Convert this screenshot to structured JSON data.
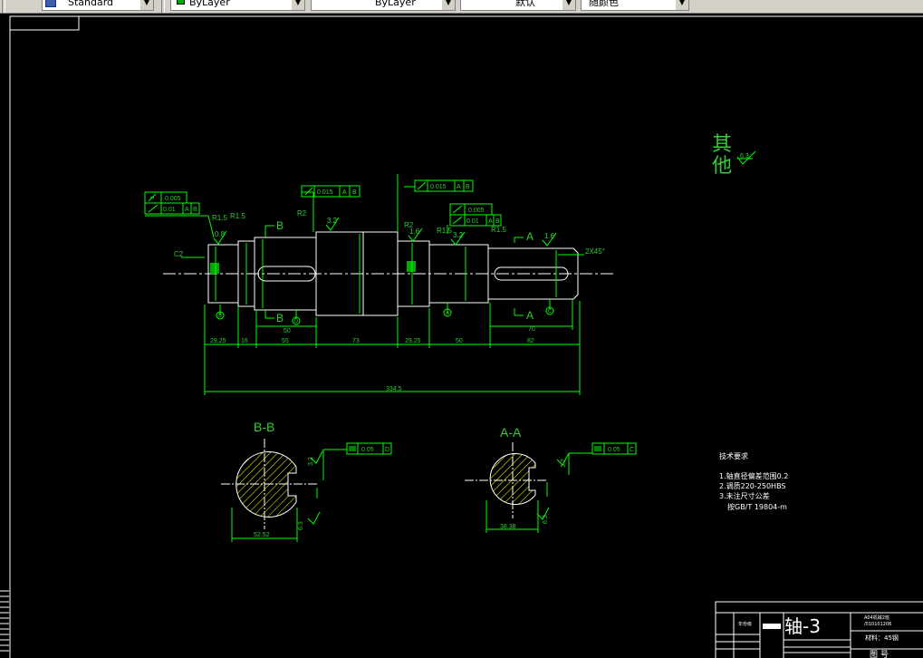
{
  "toolbar": {
    "text_style": "Standard",
    "layer_color": "ByLayer",
    "linetype": "ByLayer",
    "lineweight": "默认",
    "plot_color": "随颜色",
    "layer_color_hex": "#00aa00"
  },
  "drawing": {
    "colors": {
      "background": "#000000",
      "outline": "#ffffff",
      "dimension": "#00ff00",
      "text": "#33cc33",
      "hatch": "#ffff00"
    },
    "roughness_title_line1": "其",
    "roughness_title_line2": "他",
    "roughness_value": "6.3",
    "tolerance_frames": {
      "runout_1": "0.005",
      "runout_2": "0.01",
      "runout_2_datum_1": "A",
      "runout_2_datum_2": "B",
      "runout_3": "0.015",
      "runout_3_datum_1": "A",
      "runout_3_datum_2": "B",
      "runout_4": "0.015",
      "runout_4_datum_1": "A",
      "runout_4_datum_2": "B",
      "runout_5": "0.005",
      "runout_6": "0.01",
      "runout_6_datum_1": "A",
      "runout_6_datum_2": "B",
      "sym_bb": "0.05",
      "sym_bb_datum": "D",
      "sym_aa": "0.05",
      "sym_aa_datum": "C"
    },
    "labels": {
      "r15_1": "R1.5",
      "r15_2": "R1.5",
      "r15_3": "R1.5",
      "r15_4": "R1.5",
      "r2_1": "R2",
      "r2_2": "R2",
      "c2": "C2",
      "chamfer": "2X45°",
      "rough_08": "0.8",
      "rough_32_1": "3.2",
      "rough_16_1": "1.6",
      "rough_32_2": "3.2",
      "rough_16_2": "1.6",
      "sec_b_1": "B",
      "sec_b_2": "B",
      "sec_a_1": "A",
      "sec_a_2": "A",
      "datum_b": "B",
      "datum_d": "D",
      "datum_a": "A",
      "datum_c": "C"
    },
    "dims": {
      "d1": "29.25",
      "d2": "16",
      "d3": "55",
      "d4": "73",
      "d5": "29.25",
      "d6": "50",
      "d7": "82",
      "d8": "50",
      "d9": "70",
      "total": "334.5"
    },
    "section_bb": {
      "title": "B-B",
      "dim": "52.52",
      "rough_1": "3.2",
      "rough_2": "6.3"
    },
    "section_aa": {
      "title": "A-A",
      "dim": "38.38",
      "rough_1": "3.2",
      "rough_2": "6.3"
    },
    "tech_req": {
      "title": "技术要求",
      "line1": "1.轴直径偏差范围0.2",
      "line2": "2.调质220-250HBS",
      "line3": "3.未注尺寸公差",
      "line4": "按GB/T 19804-m"
    },
    "title_block": {
      "part_name": "轴-3",
      "school": "A04机械2班",
      "student_id": "/010101206",
      "material": "材料：45钢",
      "drawing_no": "图 号",
      "label_small": "年份级"
    }
  }
}
